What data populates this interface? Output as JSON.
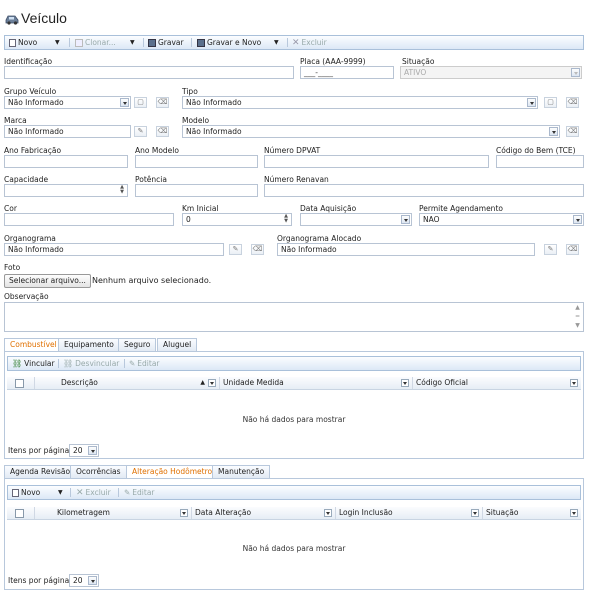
{
  "page": {
    "title": "Veículo"
  },
  "toolbar": {
    "novo": "Novo",
    "clonar": "Clonar...",
    "gravar": "Gravar",
    "gravar_novo": "Gravar e Novo",
    "excluir": "Excluir"
  },
  "form": {
    "identificacao": {
      "label": "Identificação",
      "value": ""
    },
    "placa": {
      "label": "Placa (AAA-9999)",
      "value": "___-____"
    },
    "situacao": {
      "label": "Situação",
      "value": "ATIVO"
    },
    "grupo_veiculo": {
      "label": "Grupo Veículo",
      "value": "Não Informado"
    },
    "tipo": {
      "label": "Tipo",
      "value": "Não Informado"
    },
    "marca": {
      "label": "Marca",
      "value": "Não Informado"
    },
    "modelo": {
      "label": "Modelo",
      "value": "Não Informado"
    },
    "ano_fabricacao": {
      "label": "Ano Fabricação",
      "value": ""
    },
    "ano_modelo": {
      "label": "Ano Modelo",
      "value": ""
    },
    "numero_dpvat": {
      "label": "Número DPVAT",
      "value": ""
    },
    "codigo_bem": {
      "label": "Código do Bem (TCE)",
      "value": ""
    },
    "capacidade": {
      "label": "Capacidade",
      "value": ""
    },
    "potencia": {
      "label": "Potência",
      "value": ""
    },
    "numero_renavan": {
      "label": "Número Renavan",
      "value": ""
    },
    "cor": {
      "label": "Cor",
      "value": ""
    },
    "km_inicial": {
      "label": "Km Inicial",
      "value": "0"
    },
    "data_aquisicao": {
      "label": "Data Aquisição",
      "value": ""
    },
    "permite_agendamento": {
      "label": "Permite Agendamento",
      "value": "NAO"
    },
    "organograma": {
      "label": "Organograma",
      "value": "Não Informado"
    },
    "organograma_alocado": {
      "label": "Organograma Alocado",
      "value": "Não Informado"
    },
    "foto": {
      "label": "Foto",
      "button": "Selecionar arquivo...",
      "status": "Nenhum arquivo selecionado."
    },
    "observacao": {
      "label": "Observação",
      "value": ""
    }
  },
  "tabs1": {
    "items": [
      "Combustível",
      "Equipamento",
      "Seguro",
      "Aluguel"
    ],
    "active": 0,
    "toolbar": {
      "vincular": "Vincular",
      "desvincular": "Desvincular",
      "editar": "Editar"
    },
    "columns": [
      "Descrição",
      "Unidade Medida",
      "Código Oficial"
    ],
    "empty": "Não há dados para mostrar",
    "page_size_label": "Itens por página:",
    "page_size": "20"
  },
  "tabs2": {
    "items": [
      "Agenda Revisão",
      "Ocorrências",
      "Alteração Hodômetro",
      "Manutenção"
    ],
    "active": 2,
    "toolbar": {
      "novo": "Novo",
      "excluir": "Excluir",
      "editar": "Editar"
    },
    "columns": [
      "Kilometragem",
      "Data Alteração",
      "Login Inclusão",
      "Situação"
    ],
    "empty": "Não há dados para mostrar",
    "page_size_label": "Itens por página:",
    "page_size": "20"
  },
  "colors": {
    "accent": "#e07000",
    "toolbar_border": "#a9c0da",
    "active_tab_text": "#e07000"
  }
}
